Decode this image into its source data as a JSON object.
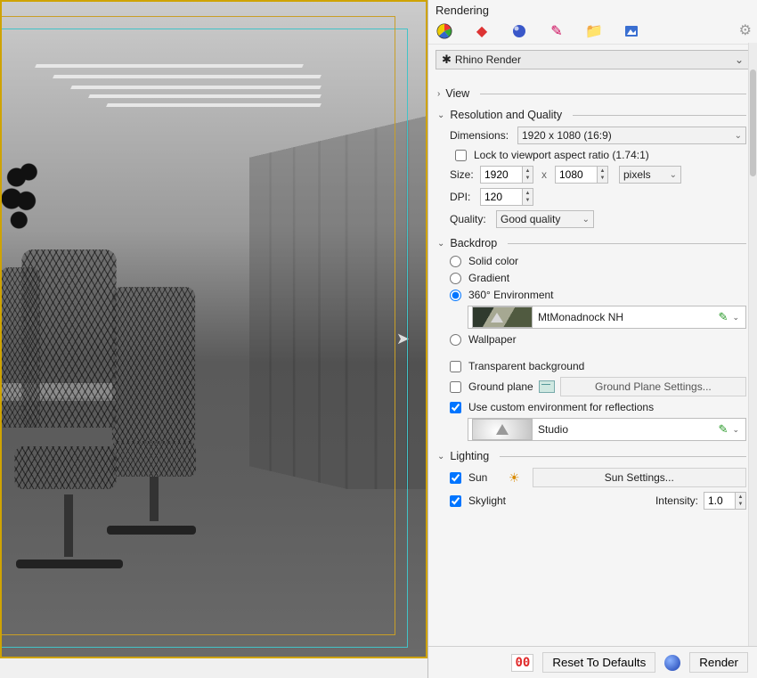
{
  "panel": {
    "title": "Rendering",
    "renderer": "Rhino Render"
  },
  "sections": {
    "view": {
      "label": "View"
    },
    "resQual": {
      "label": "Resolution and Quality",
      "dimensionsLabel": "Dimensions:",
      "dimensionsValue": "1920 x 1080 (16:9)",
      "lockAspectLabel": "Lock to viewport aspect ratio (1.74:1)",
      "sizeLabel": "Size:",
      "sizeW": "1920",
      "sizeH": "1080",
      "sizeUnits": "pixels",
      "dpiLabel": "DPI:",
      "dpiValue": "120",
      "qualityLabel": "Quality:",
      "qualityValue": "Good quality"
    },
    "backdrop": {
      "label": "Backdrop",
      "solid": "Solid color",
      "gradient": "Gradient",
      "env360": "360° Environment",
      "envName": "MtMonadnock NH",
      "wallpaper": "Wallpaper",
      "transparentBg": "Transparent background",
      "groundPlane": "Ground plane",
      "groundPlaneBtn": "Ground Plane Settings...",
      "customEnvRefl": "Use custom environment for reflections",
      "studioName": "Studio"
    },
    "lighting": {
      "label": "Lighting",
      "sun": "Sun",
      "sunBtn": "Sun Settings...",
      "skylight": "Skylight",
      "intensityLabel": "Intensity:",
      "intensityValue": "1.0"
    }
  },
  "footer": {
    "counter": "00",
    "reset": "Reset To Defaults",
    "render": "Render"
  }
}
